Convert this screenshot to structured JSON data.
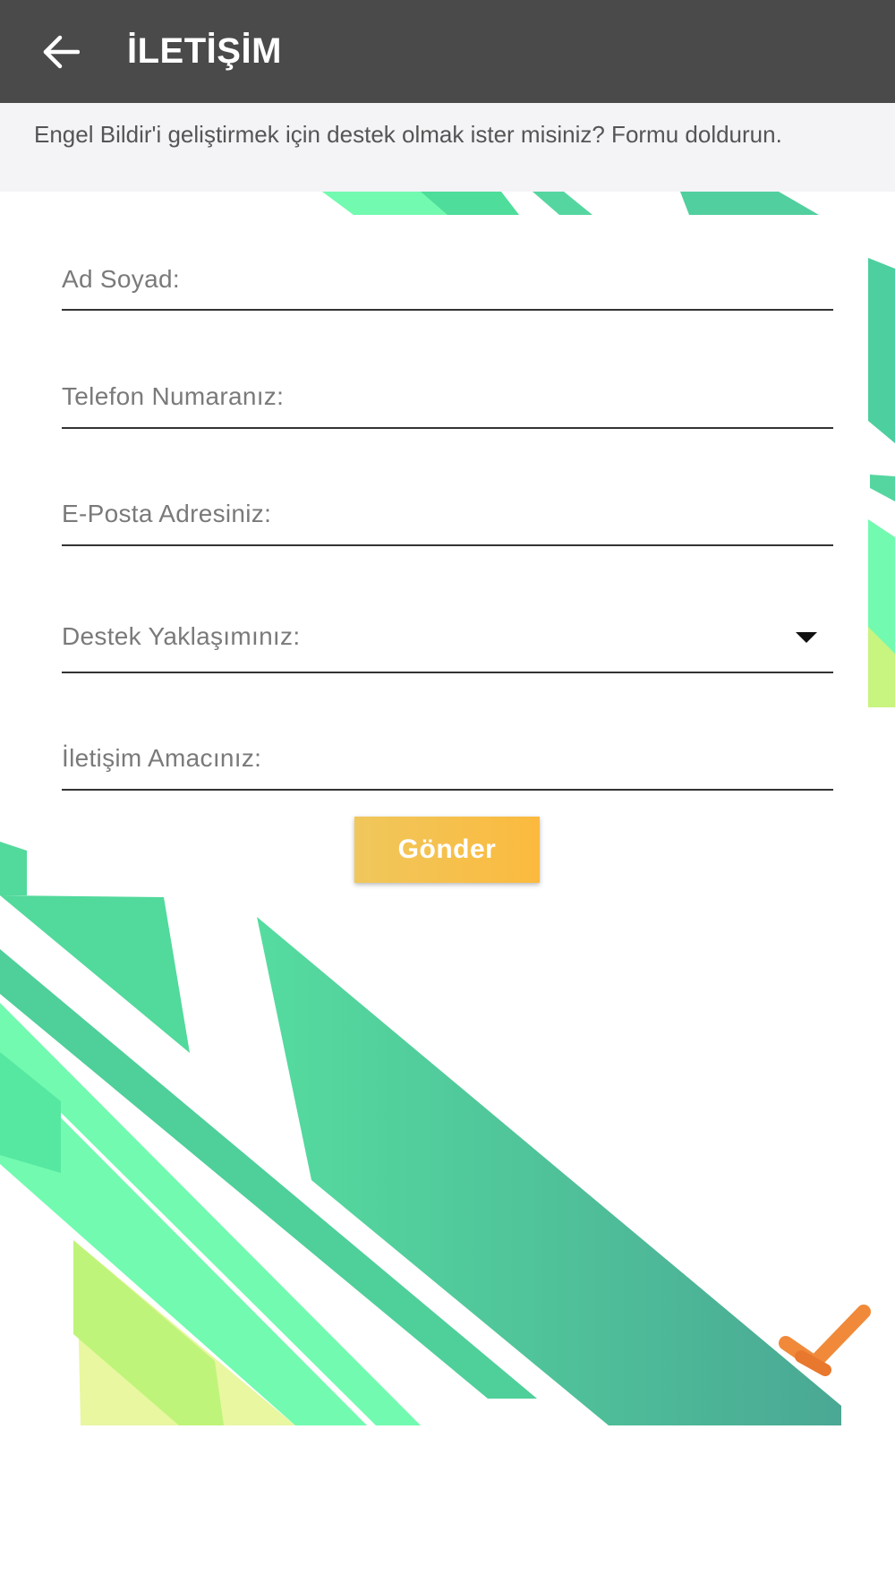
{
  "header": {
    "title": "İLETİŞİM",
    "back_icon": "arrow-left-icon"
  },
  "info": {
    "text": "Engel Bildir'i geliştirmek için destek olmak ister misiniz? Formu doldurun."
  },
  "form": {
    "name_label": "Ad Soyad:",
    "phone_label": "Telefon Numaranız:",
    "email_label": "E-Posta Adresiniz:",
    "support_label": "Destek Yaklaşımınız:",
    "purpose_label": "İletişim Amacınız:",
    "submit_label": "Gönder"
  },
  "colors": {
    "appbar": "#4a4a4a",
    "accent_green": "#52d79a",
    "light_green": "#72fab0",
    "lime": "#e8f7a0",
    "button": "#fbba3e",
    "check": "#f08a3a"
  },
  "icons": {
    "dropdown": "caret-down-icon",
    "logo": "double-check-icon"
  }
}
